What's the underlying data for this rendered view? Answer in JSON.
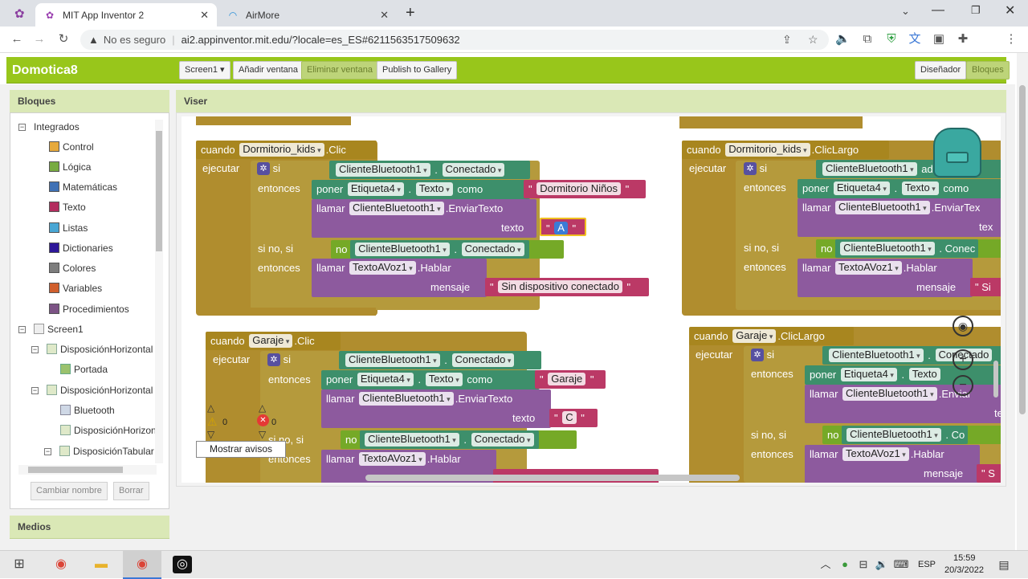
{
  "browser": {
    "tabs": [
      {
        "title": "MIT App Inventor 2",
        "active": true
      },
      {
        "title": "AirMore",
        "active": false
      }
    ],
    "security_label": "No es seguro",
    "url": "ai2.appinventor.mit.edu/?locale=es_ES#6211563517509632"
  },
  "app": {
    "name": "Domotica8",
    "screen_dropdown": "Screen1",
    "buttons": {
      "add_window": "Añadir ventana",
      "remove_window": "Eliminar ventana",
      "publish": "Publish to Gallery",
      "designer": "Diseñador",
      "blocks": "Bloques"
    }
  },
  "blocks_panel": {
    "title": "Bloques",
    "root": "Integrados",
    "builtins": [
      {
        "label": "Control",
        "color": "#e6a93b"
      },
      {
        "label": "Lógica",
        "color": "#77ab41"
      },
      {
        "label": "Matemáticas",
        "color": "#3f71b5"
      },
      {
        "label": "Texto",
        "color": "#b32d5e"
      },
      {
        "label": "Listas",
        "color": "#49a6d4"
      },
      {
        "label": "Dictionaries",
        "color": "#2d1799"
      },
      {
        "label": "Colores",
        "color": "#7d7d7d"
      },
      {
        "label": "Variables",
        "color": "#d05f2d"
      },
      {
        "label": "Procedimientos",
        "color": "#7c5385"
      }
    ],
    "screen": "Screen1",
    "components": [
      "DisposiciónHorizontal",
      "Portada",
      "DisposiciónHorizontal",
      "Bluetooth",
      "DisposiciónHorizon",
      "DisposiciónTabular"
    ],
    "rename_button": "Cambiar nombre",
    "delete_button": "Borrar"
  },
  "media_panel": {
    "title": "Medios"
  },
  "viewer": {
    "title": "Viser",
    "warnings_count": "0",
    "errors_count": "0",
    "show_warnings_button": "Mostrar avisos",
    "words": {
      "cuando": "cuando",
      "ejecutar": "ejecutar",
      "si": "si",
      "entonces": "entonces",
      "si_no_si": "si no, si",
      "poner": "poner",
      "como": "como",
      "llamar": "llamar",
      "texto": "texto",
      "mensaje": "mensaje",
      "no": "no"
    },
    "names": {
      "dormitorio": "Dormitorio_kids",
      "garaje": "Garaje",
      "bt": "ClienteBluetooth1",
      "conectado": "Conectado",
      "etiqueta": "Etiqueta4",
      "texto_prop": "Texto",
      "enviar": ".EnviarTexto",
      "tts": "TextoAVoz1",
      "hablar": ".Hablar",
      "clic": ".Clic",
      "clic_largo": ".ClicLargo"
    },
    "strings": {
      "dormitorio_ninos": "Dormitorio Niños",
      "a": "A",
      "sin_dispositivo": "Sin dispositivo conectado",
      "garaje": "Garaje",
      "c": "C"
    },
    "truncated": {
      "conectado_cut": "Conectado",
      "conec": "Conec",
      "enviartext_cut": ".EnviarTex",
      "tex": "tex",
      "si_cut": "Si",
      "co": "Co",
      "enviar_cut": ".Enviar",
      "te": "te",
      "s": "S",
      "conectado_cut2": "Conectado",
      "texto_cut": "Texto",
      "ado": "ado"
    }
  },
  "taskbar": {
    "language": "ESP",
    "time": "15:59",
    "date": "20/3/2022"
  }
}
